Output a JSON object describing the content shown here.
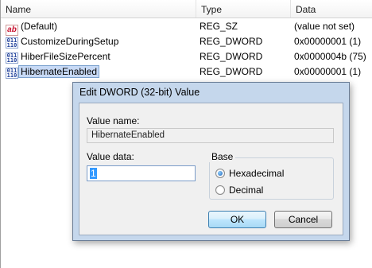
{
  "list": {
    "columns": {
      "name": "Name",
      "type": "Type",
      "data": "Data"
    },
    "rows": [
      {
        "icon": "string-value-icon",
        "icon_text": "ab",
        "name": "(Default)",
        "type": "REG_SZ",
        "data": "(value not set)"
      },
      {
        "icon": "binary-value-icon",
        "icon_text": "011\n110",
        "name": "CustomizeDuringSetup",
        "type": "REG_DWORD",
        "data": "0x00000001 (1)"
      },
      {
        "icon": "binary-value-icon",
        "icon_text": "011\n110",
        "name": "HiberFileSizePercent",
        "type": "REG_DWORD",
        "data": "0x0000004b (75)"
      },
      {
        "icon": "binary-value-icon",
        "icon_text": "011\n110",
        "name": "HibernateEnabled",
        "type": "REG_DWORD",
        "data": "0x00000001 (1)"
      }
    ]
  },
  "dialog": {
    "title": "Edit DWORD (32-bit) Value",
    "value_name_label": "Value name:",
    "value_name": "HibernateEnabled",
    "value_data_label": "Value data:",
    "value_data": "1",
    "base_label": "Base",
    "base_options": [
      {
        "label": "Hexadecimal",
        "checked": true
      },
      {
        "label": "Decimal",
        "checked": false
      }
    ],
    "ok_label": "OK",
    "cancel_label": "Cancel"
  },
  "colors": {
    "dialog_frame": "#c5d7ec",
    "selection": "#3399ff",
    "row_selected": "#c7d9f5"
  }
}
